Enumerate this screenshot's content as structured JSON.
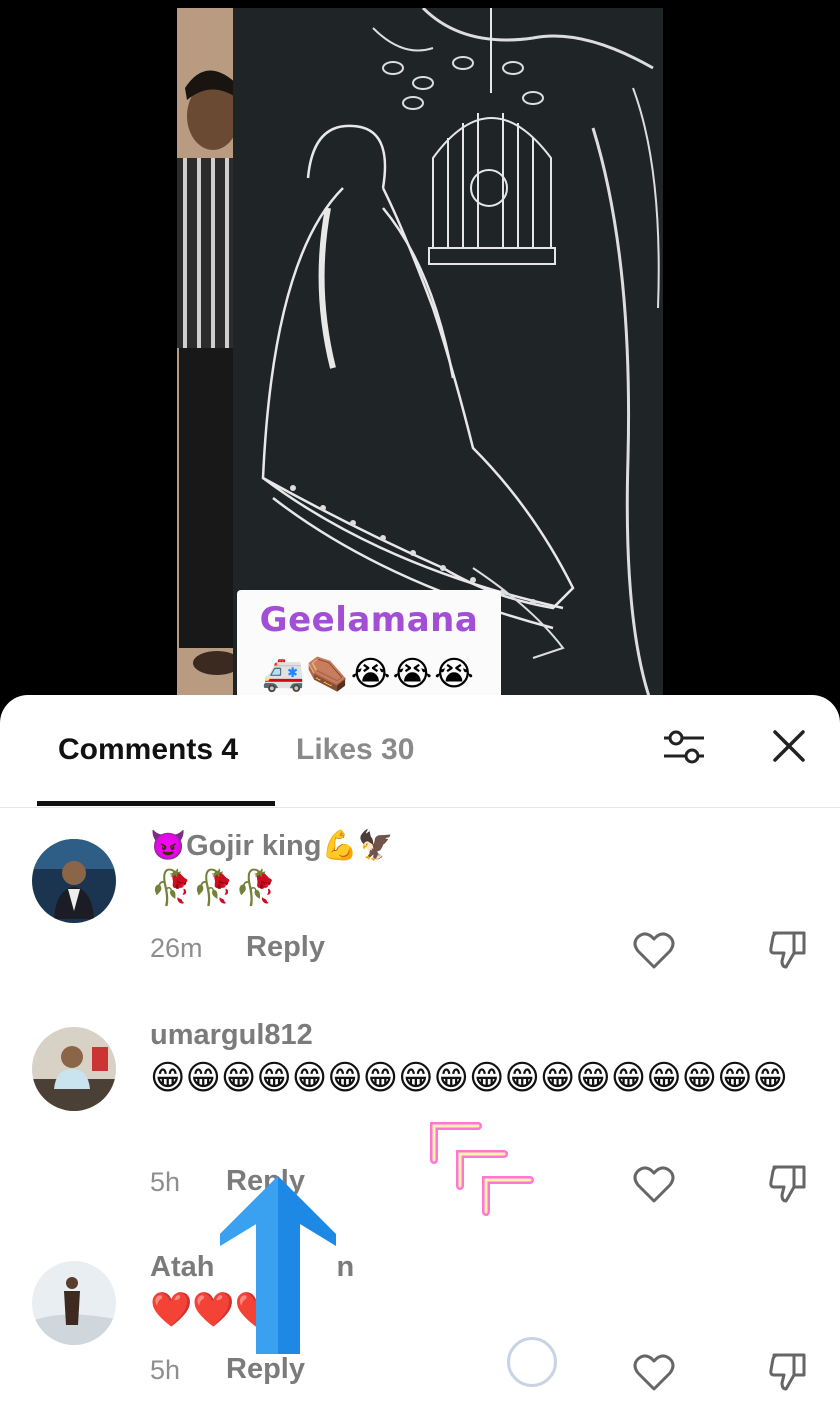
{
  "video": {
    "caption_title": "Geelamana",
    "caption_emoji": "🚑⚰️😭😭😭"
  },
  "tabs": {
    "comments_label": "Comments 4",
    "likes_label": "Likes 30"
  },
  "comments": [
    {
      "username": "😈Gojir king💪🦅",
      "text": "🥀🥀🥀",
      "time": "26m",
      "reply_label": "Reply"
    },
    {
      "username": "umargul812",
      "text": "😁😁😁😁😁😁😁😁😁😁😁😁😁😁😁😁😁😁",
      "time": "5h",
      "reply_label": "Reply"
    },
    {
      "username": "Atah",
      "username_tail": "n",
      "text": "❤️❤️❤️",
      "time": "5h",
      "reply_label": "Reply"
    }
  ],
  "icons": {
    "filter": "filter-sliders-icon",
    "close": "close-icon",
    "like": "heart-outline-icon",
    "dislike": "thumbs-down-outline-icon"
  }
}
